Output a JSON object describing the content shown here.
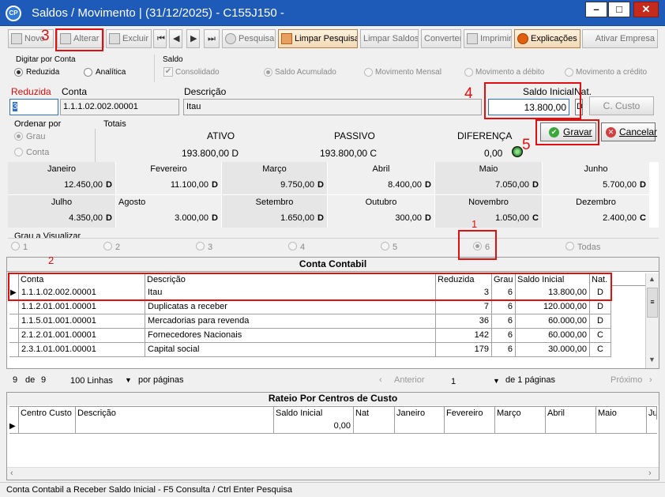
{
  "window": {
    "title": "Saldos / Movimento | (31/12/2025) - C155J150 -",
    "logo": "CP"
  },
  "toolbar": {
    "novo": "Novo",
    "alterar": "Alterar",
    "excluir": "Excluir",
    "pesquisa": "Pesquisa",
    "limpar_pesquisa": "Limpar Pesquisa",
    "limpar_saldos": "Limpar Saldos",
    "converter": "Converter",
    "imprimir": "Imprimir",
    "explicacoes": "Explicações",
    "ativar_empresa": "Ativar Empresa"
  },
  "digitar": {
    "label": "Digitar por Conta",
    "reduzida": "Reduzida",
    "analitica": "Analítica"
  },
  "saldo": {
    "label": "Saldo",
    "consolidado": "Consolidado",
    "acumulado": "Saldo Acumulado",
    "mensal": "Movimento Mensal",
    "debito": "Movimento a débito",
    "credito": "Movimento a crédito"
  },
  "form": {
    "reduzida_label": "Reduzida",
    "reduzida_value": "3",
    "conta_label": "Conta",
    "conta_value": "1.1.1.02.002.00001",
    "descricao_label": "Descrição",
    "descricao_value": "Itau",
    "saldo_inicial_label": "Saldo Inicial",
    "saldo_inicial_value": "13.800,00",
    "nat_label": "Nat.",
    "nat_value": "D",
    "ccusto_label": "C. Custo"
  },
  "ordenar": {
    "label": "Ordenar por",
    "grau": "Grau",
    "conta": "Conta"
  },
  "totais": {
    "label": "Totais",
    "ativo_label": "ATIVO",
    "passivo_label": "PASSIVO",
    "diferenca_label": "DIFERENÇA",
    "ativo": "193.800,00 D",
    "passivo": "193.800,00 C",
    "diferenca": "0,00"
  },
  "actions": {
    "gravar": "Gravar",
    "cancelar": "Cancelar"
  },
  "months": [
    {
      "name": "Janeiro",
      "value": "12.450,00",
      "nat": "D"
    },
    {
      "name": "Fevereiro",
      "value": "11.100,00",
      "nat": "D"
    },
    {
      "name": "Março",
      "value": "9.750,00",
      "nat": "D"
    },
    {
      "name": "Abril",
      "value": "8.400,00",
      "nat": "D"
    },
    {
      "name": "Maio",
      "value": "7.050,00",
      "nat": "D"
    },
    {
      "name": "Junho",
      "value": "5.700,00",
      "nat": "D"
    },
    {
      "name": "Julho",
      "value": "4.350,00",
      "nat": "D"
    },
    {
      "name": "Agosto",
      "value": "3.000,00",
      "nat": "D"
    },
    {
      "name": "Setembro",
      "value": "1.650,00",
      "nat": "D"
    },
    {
      "name": "Outubro",
      "value": "300,00",
      "nat": "D"
    },
    {
      "name": "Novembro",
      "value": "1.050,00",
      "nat": "C"
    },
    {
      "name": "Dezembro",
      "value": "2.400,00",
      "nat": "C"
    }
  ],
  "grau": {
    "label": "Grau a Visualizar",
    "options": [
      "1",
      "2",
      "3",
      "4",
      "5",
      "6",
      "Todas"
    ],
    "selected": "6"
  },
  "grid": {
    "title": "Conta Contabil",
    "headers": [
      "Conta",
      "Descrição",
      "Reduzida",
      "Grau",
      "Saldo Inicial",
      "Nat."
    ],
    "rows": [
      [
        "1.1.1.02.002.00001",
        "Itau",
        "3",
        "6",
        "13.800,00",
        "D"
      ],
      [
        "1.1.2.01.001.00001",
        "Duplicatas a receber",
        "7",
        "6",
        "120.000,00",
        "D"
      ],
      [
        "1.1.5.01.001.00001",
        "Mercadorias para revenda",
        "36",
        "6",
        "60.000,00",
        "D"
      ],
      [
        "2.1.2.01.001.00001",
        "Fornecedores Nacionais",
        "142",
        "6",
        "60.000,00",
        "C"
      ],
      [
        "2.3.1.01.001.00001",
        "Capital social",
        "179",
        "6",
        "30.000,00",
        "C"
      ]
    ]
  },
  "pager": {
    "count": "9",
    "de": "de",
    "total": "9",
    "lines": "100 Linhas",
    "por_paginas": "por páginas",
    "anterior": "Anterior",
    "page": "1",
    "de_paginas": "de 1 páginas",
    "proximo": "Próximo"
  },
  "rateio": {
    "title": "Rateio Por Centros de Custo",
    "headers": [
      "Centro Custo",
      "Descrição",
      "Saldo Inicial",
      "Nat",
      "Janeiro",
      "Fevereiro",
      "Março",
      "Abril",
      "Maio",
      "Ju"
    ],
    "row_saldo": "0,00"
  },
  "annotations": [
    "1",
    "2",
    "3",
    "4",
    "5"
  ],
  "status": "Conta Contabil a Receber Saldo Inicial - F5 Consulta / Ctrl Enter Pesquisa",
  "colors": {
    "title_bar": "#1e5bb8",
    "annotation_red": "#e01010"
  }
}
